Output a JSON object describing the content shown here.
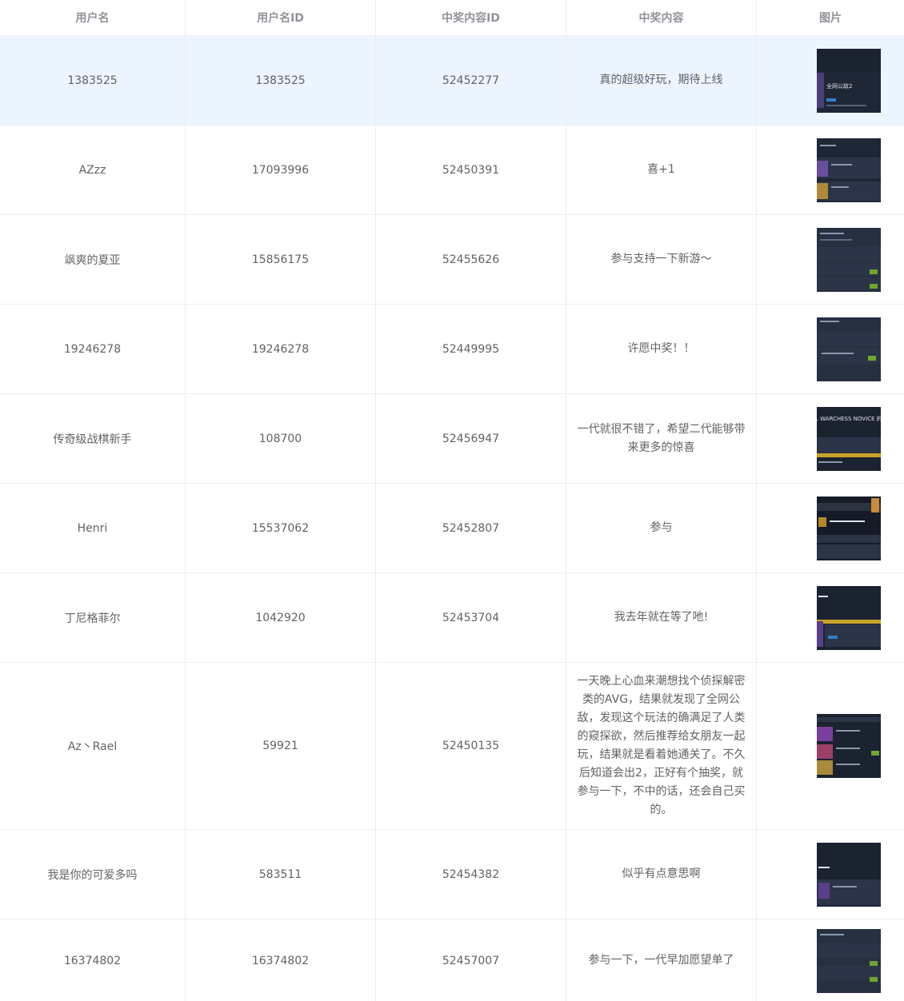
{
  "columns": [
    "用户名",
    "用户名ID",
    "中奖内容ID",
    "中奖内容",
    "图片"
  ],
  "rows": [
    {
      "username": "1383525",
      "user_id": "1383525",
      "content_id": "52452277",
      "content": "真的超级好玩，期待上线"
    },
    {
      "username": "AZzz",
      "user_id": "17093996",
      "content_id": "52450391",
      "content": "喜+1"
    },
    {
      "username": "飒爽的夏亚",
      "user_id": "15856175",
      "content_id": "52455626",
      "content": "参与支持一下新游～"
    },
    {
      "username": "19246278",
      "user_id": "19246278",
      "content_id": "52449995",
      "content": "许愿中奖！！"
    },
    {
      "username": "传奇级战棋新手",
      "user_id": "108700",
      "content_id": "52456947",
      "content": "一代就很不错了，希望二代能够带来更多的惊喜"
    },
    {
      "username": "Henri",
      "user_id": "15537062",
      "content_id": "52452807",
      "content": "参与"
    },
    {
      "username": "丁尼格菲尔",
      "user_id": "1042920",
      "content_id": "52453704",
      "content": "我去年就在等了吔!"
    },
    {
      "username": "Az丶Rael",
      "user_id": "59921",
      "content_id": "52450135",
      "content": "一天晚上心血来潮想找个侦探解密类的AVG，结果就发现了全网公敌，发现这个玩法的确满足了人类的窥探欲，然后推荐给女朋友一起玩，结果就是看着她通关了。不久后知道会出2，正好有个抽奖，就参与一下，不中的话，还会自己买的。"
    },
    {
      "username": "我是你的可爱多吗",
      "user_id": "583511",
      "content_id": "52454382",
      "content": "似乎有点意思啊"
    },
    {
      "username": "16374802",
      "user_id": "16374802",
      "content_id": "52457007",
      "content": "参与一下，一代早加愿望单了"
    }
  ],
  "thumbnails": [
    {
      "caption": "全网公敌2"
    },
    {
      "caption": ""
    },
    {
      "caption": ""
    },
    {
      "caption": ""
    },
    {
      "caption": "L WARCHESS NOVICE 的"
    },
    {
      "caption": ""
    },
    {
      "caption": ""
    },
    {
      "caption": ""
    },
    {
      "caption": ""
    },
    {
      "caption": ""
    }
  ],
  "colors": {
    "header_text": "#909399",
    "body_text": "#606266",
    "border": "#ebeef5",
    "highlight_row": "#ecf5ff",
    "thumb_bg": "#1f2737"
  }
}
